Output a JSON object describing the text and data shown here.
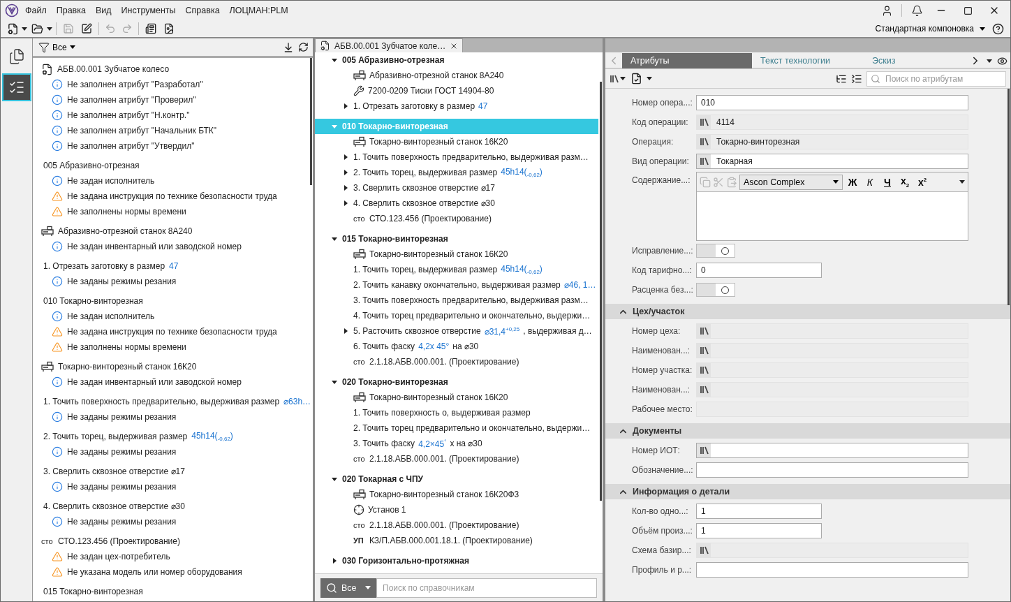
{
  "menu_bar": {
    "items": [
      "Файл",
      "Правка",
      "Вид",
      "Инструменты",
      "Справка",
      "ЛОЦМАН:PLM"
    ]
  },
  "layout_selector": "Стандартная компоновка",
  "sidebar": {
    "items": [
      {
        "kind": "documents",
        "selected": false
      },
      {
        "kind": "checks",
        "selected": true
      }
    ]
  },
  "check_panel": {
    "filter": "Все",
    "groups": [
      {
        "kind": "document",
        "text": "АБВ.00.001 Зубчатое колесо",
        "messages": [
          {
            "kind": "info",
            "text": "Не заполнен атрибут \"Разработал\""
          },
          {
            "kind": "info",
            "text": "Не заполнен атрибут \"Проверил\""
          },
          {
            "kind": "info",
            "text": "Не заполнен атрибут \"Н.контр.\""
          },
          {
            "kind": "info",
            "text": "Не заполнен атрибут \"Начальник БТК\""
          },
          {
            "kind": "info",
            "text": "Не заполнен атрибут \"Утвердил\""
          }
        ]
      },
      {
        "kind": "operation",
        "text": "005 Абразивно-отрезная",
        "messages": [
          {
            "kind": "info",
            "text": "Не задан исполнитель"
          },
          {
            "kind": "warning",
            "text": "Не задана инструкция по технике безопасности труда"
          },
          {
            "kind": "warning",
            "text": "Не заполнены нормы времени"
          }
        ]
      },
      {
        "kind": "machine",
        "text": "Абразивно-отрезной станок 8А240",
        "messages": [
          {
            "kind": "info",
            "text": "Не задан инвентарный или заводской номер"
          }
        ]
      },
      {
        "kind": "step",
        "text": "1. Отрезать заготовку в размер ",
        "value": "47",
        "messages": [
          {
            "kind": "info",
            "text": "Не заданы режимы резания"
          }
        ]
      },
      {
        "kind": "operation",
        "text": "010 Токарно-винторезная",
        "messages": [
          {
            "kind": "info",
            "text": "Не задан исполнитель"
          },
          {
            "kind": "warning",
            "text": "Не задана инструкция по технике безопасности труда"
          },
          {
            "kind": "warning",
            "text": "Не заполнены нормы времени"
          }
        ]
      },
      {
        "kind": "machine",
        "text": "Токарно-винторезный станок 16К20",
        "messages": [
          {
            "kind": "info",
            "text": "Не задан инвентарный или заводской номер"
          }
        ]
      },
      {
        "kind": "step",
        "text": "1. Точить поверхность предварительно, выдерживая размер ",
        "value": "⌀63h…",
        "messages": [
          {
            "kind": "info",
            "text": "Не заданы режимы резания"
          }
        ]
      },
      {
        "kind": "step",
        "text": "2. Точить торец, выдерживая размер ",
        "value": "45h14($_{-0,62}$)",
        "messages": [
          {
            "kind": "info",
            "text": "Не заданы режимы резания"
          }
        ]
      },
      {
        "kind": "step",
        "text": "3. Сверлить сквозное отверстие ⌀17",
        "messages": [
          {
            "kind": "info",
            "text": "Не заданы режимы резания"
          }
        ]
      },
      {
        "kind": "step",
        "text": "4. Сверлить сквозное отверстие ⌀30",
        "messages": [
          {
            "kind": "info",
            "text": "Не заданы режимы резания"
          }
        ]
      },
      {
        "kind": "standard",
        "prefix": "сто",
        "text": "СТО.123.456 (Проектирование)",
        "messages": [
          {
            "kind": "warning",
            "text": "Не задан цех-потребитель"
          },
          {
            "kind": "warning",
            "text": "Не указана модель или номер оборудования"
          }
        ]
      },
      {
        "kind": "operation",
        "text": "015 Токарно-винторезная"
      }
    ]
  },
  "document_tab": {
    "title": "АБВ.00.001 Зубчатое коле…"
  },
  "tree": {
    "operations": [
      {
        "text": "005 Абразивно-отрезная",
        "expanded": true,
        "selected": false,
        "children": [
          {
            "kind": "machine",
            "text": "Абразивно-отрезной станок 8А240"
          },
          {
            "kind": "fixture",
            "text": "7200-0209 Тиски ГОСТ 14904-80"
          },
          {
            "kind": "step",
            "text": "1. Отрезать заготовку в размер ",
            "value": "47",
            "expanded": false
          }
        ]
      },
      {
        "text": "010 Токарно-винторезная",
        "expanded": true,
        "selected": true,
        "children": [
          {
            "kind": "machine",
            "text": "Токарно-винторезный станок 16К20"
          },
          {
            "kind": "step",
            "text": "1. Точить поверхность предварительно, выдерживая разм…",
            "expanded": false
          },
          {
            "kind": "step",
            "text": "2. Точить торец, выдерживая размер ",
            "value": "45h14($_{-0,62}$)",
            "expanded": false
          },
          {
            "kind": "step",
            "text": "3. Сверлить сквозное отверстие ⌀17",
            "expanded": false
          },
          {
            "kind": "step",
            "text": "4. Сверлить сквозное отверстие ⌀30",
            "expanded": false
          },
          {
            "kind": "standard",
            "prefix": "сто",
            "text": "СТО.123.456 (Проектирование)"
          }
        ]
      },
      {
        "text": "015 Токарно-винторезная",
        "expanded": true,
        "selected": false,
        "children": [
          {
            "kind": "machine",
            "text": "Токарно-винторезный станок 16К20"
          },
          {
            "kind": "step",
            "text": "1. Точить торец, выдерживая размер ",
            "value": "45h14($_{-0,62}$)"
          },
          {
            "kind": "step",
            "text": "2. Точить канавку окончательно, выдерживая размер ",
            "value": "⌀46, 1…"
          },
          {
            "kind": "step",
            "text": "3. Точить поверхность предварительно, выдерживая разм…"
          },
          {
            "kind": "step",
            "text": "4. Точить торец предварительно и окончательно, выдержи…"
          },
          {
            "kind": "step",
            "text": "5. Расточить сквозное отверстие ",
            "value": "⌀31,4$^{+0,25}$",
            "tail": ", выдерживая д…",
            "expanded": false
          },
          {
            "kind": "step",
            "text": "6. Точить фаску ",
            "value": "4,2x 45°",
            "tail": "  на ⌀30"
          },
          {
            "kind": "standard",
            "prefix": "сто",
            "text": "2.1.18.АБВ.000.001. (Проектирование)"
          }
        ]
      },
      {
        "text": "020 Токарно-винторезная",
        "expanded": true,
        "selected": false,
        "children": [
          {
            "kind": "machine",
            "text": "Токарно-винторезный станок 16К20"
          },
          {
            "kind": "step",
            "text": "1. Точить поверхность о, выдерживая размер"
          },
          {
            "kind": "step",
            "text": "2. Точить торец предварительно и окончательно, выдержи…"
          },
          {
            "kind": "step",
            "text": "3. Точить фаску ",
            "value": "4,2×45$^{°}$",
            "tail": "x   на ⌀30"
          },
          {
            "kind": "standard",
            "prefix": "сто",
            "text": "2.1.18.АБВ.000.001. (Проектирование)"
          }
        ]
      },
      {
        "text": "020 Токарная с ЧПУ",
        "expanded": true,
        "selected": false,
        "children": [
          {
            "kind": "machine",
            "text": "Токарно-винторезный станок 16К20Ф3"
          },
          {
            "kind": "setup",
            "text": "Установ 1"
          },
          {
            "kind": "standard",
            "prefix": "сто",
            "text": "2.1.18.АБВ.000.001. (Проектирование)"
          },
          {
            "kind": "program",
            "prefix": "УП",
            "text": "КЗ/П.АБВ.000.001.18.1. (Проектирование)"
          }
        ]
      },
      {
        "text": "030 Горизонтально-протяжная",
        "expanded": false,
        "selected": false
      }
    ]
  },
  "reference_search": {
    "scope": "Все",
    "placeholder": "Поиск по справочникам"
  },
  "attributes_panel": {
    "tabs": [
      {
        "label": "Атрибуты",
        "selected": true
      },
      {
        "label": "Текст технологии",
        "selected": false
      },
      {
        "label": "Эскиз",
        "selected": false
      }
    ],
    "search_placeholder": "Поиск по атрибутам",
    "fields": [
      {
        "kind": "text",
        "label": "Номер опера...:",
        "value": "010"
      },
      {
        "kind": "lookup",
        "label": "Код операции:",
        "value": "4114",
        "disabled": true
      },
      {
        "kind": "lookup",
        "label": "Операция:",
        "value": "Токарно-винторезная",
        "disabled": true
      },
      {
        "kind": "lookup",
        "label": "Вид операции:",
        "value": "Токарная",
        "disabled": false
      },
      {
        "kind": "richtext",
        "label": "Содержание...:",
        "font": "Ascon Complex",
        "format_buttons": [
          "Ж",
          "К",
          "Ч",
          "x$_{2}$",
          "x$^{2}$"
        ]
      },
      {
        "kind": "toggle",
        "label": "Исправление...:",
        "on": false
      },
      {
        "kind": "number",
        "label": "Код тарифно...:",
        "value": "0"
      },
      {
        "kind": "toggle",
        "label": "Расценка без...:",
        "on": false
      }
    ],
    "sections": [
      {
        "title": "Цех/участок",
        "expanded": true,
        "fields": [
          {
            "kind": "lookup",
            "label": "Номер цеха:",
            "disabled": true
          },
          {
            "kind": "lookup",
            "label": "Наименован...:",
            "disabled": true
          },
          {
            "kind": "lookup",
            "label": "Номер участка:",
            "disabled": true
          },
          {
            "kind": "lookup",
            "label": "Наименован...:",
            "disabled": true
          },
          {
            "kind": "static",
            "label": "Рабочее место:"
          }
        ]
      },
      {
        "title": "Документы",
        "expanded": true,
        "fields": [
          {
            "kind": "lookup",
            "label": "Номер ИОТ:",
            "disabled": false
          },
          {
            "kind": "text",
            "label": "Обозначение...:"
          }
        ]
      },
      {
        "title": "Информация о детали",
        "expanded": true,
        "fields": [
          {
            "kind": "number",
            "label": "Кол-во одно...:",
            "value": "1"
          },
          {
            "kind": "number",
            "label": "Объём произ...:",
            "value": "1"
          },
          {
            "kind": "lookup",
            "label": "Схема базир...:",
            "disabled": true
          },
          {
            "kind": "text",
            "label": "Профиль и р...:"
          }
        ]
      }
    ]
  }
}
